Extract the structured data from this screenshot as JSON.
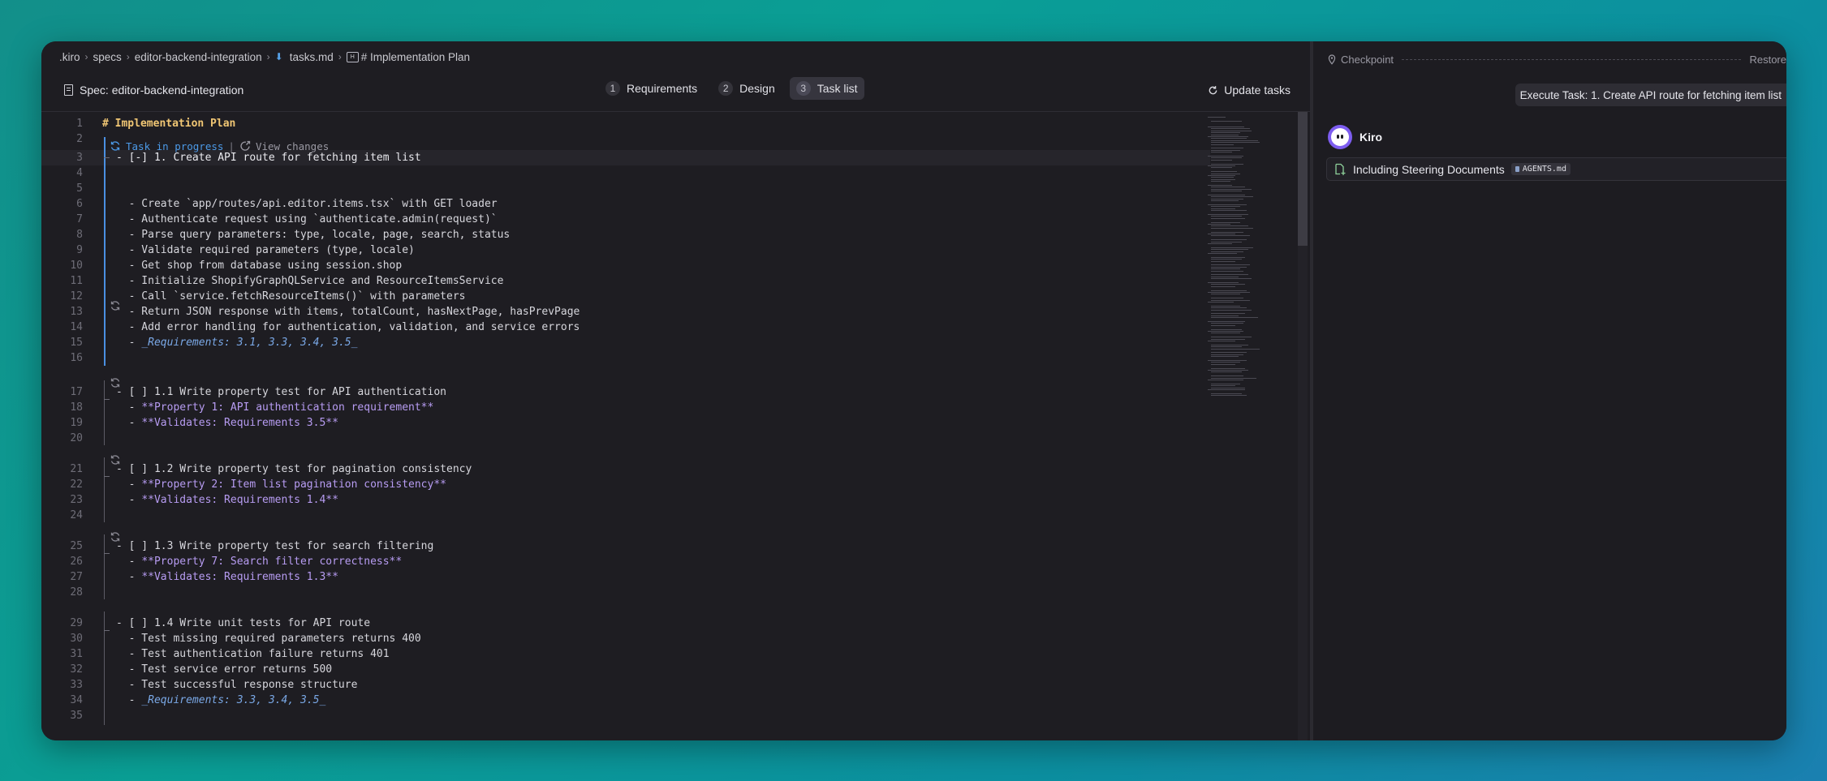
{
  "breadcrumb": {
    "items": [
      ".kiro",
      "specs",
      "editor-backend-integration",
      "tasks.md",
      "# Implementation Plan"
    ],
    "icon_md": "markdown-down-arrow-icon",
    "icon_heading": "heading-symbol-icon"
  },
  "specbar": {
    "title": "Spec: editor-backend-integration",
    "tabs": [
      {
        "num": "1",
        "label": "Requirements",
        "active": false
      },
      {
        "num": "2",
        "label": "Design",
        "active": false
      },
      {
        "num": "3",
        "label": "Task list",
        "active": true
      }
    ],
    "update_label": "Update tasks"
  },
  "lens": {
    "in_progress": "Task in progress",
    "separator": "|",
    "view_changes": "View changes"
  },
  "lines": [
    {
      "n": "1",
      "t": "# Implementation Plan"
    },
    {
      "n": "2",
      "t": ""
    },
    {
      "n": "3",
      "t": "- [-] 1. Create API route for fetching item list"
    },
    {
      "n": "4",
      "t": ""
    },
    {
      "n": "5",
      "t": ""
    },
    {
      "n": "6",
      "t": "  - Create `app/routes/api.editor.items.tsx` with GET loader"
    },
    {
      "n": "7",
      "t": "  - Authenticate request using `authenticate.admin(request)`"
    },
    {
      "n": "8",
      "t": "  - Parse query parameters: type, locale, page, search, status"
    },
    {
      "n": "9",
      "t": "  - Validate required parameters (type, locale)"
    },
    {
      "n": "10",
      "t": "  - Get shop from database using session.shop"
    },
    {
      "n": "11",
      "t": "  - Initialize ShopifyGraphQLService and ResourceItemsService"
    },
    {
      "n": "12",
      "t": "  - Call `service.fetchResourceItems()` with parameters"
    },
    {
      "n": "13",
      "t": "  - Return JSON response with items, totalCount, hasNextPage, hasPrevPage"
    },
    {
      "n": "14",
      "t": "  - Add error handling for authentication, validation, and service errors"
    },
    {
      "n": "15",
      "t": "  - ",
      "t2": "_Requirements: 3.1, 3.3, 3.4, 3.5_"
    },
    {
      "n": "16",
      "t": ""
    },
    {
      "n": "17",
      "t": "- [ ] 1.1 Write property test for API authentication"
    },
    {
      "n": "18",
      "t": "  - ",
      "t2": "**Property 1: API authentication requirement**"
    },
    {
      "n": "19",
      "t": "  - ",
      "t2": "**Validates: Requirements 3.5**"
    },
    {
      "n": "20",
      "t": ""
    },
    {
      "n": "21",
      "t": "- [ ] 1.2 Write property test for pagination consistency"
    },
    {
      "n": "22",
      "t": "  - ",
      "t2": "**Property 2: Item list pagination consistency**"
    },
    {
      "n": "23",
      "t": "  - ",
      "t2": "**Validates: Requirements 1.4**"
    },
    {
      "n": "24",
      "t": ""
    },
    {
      "n": "25",
      "t": "- [ ] 1.3 Write property test for search filtering"
    },
    {
      "n": "26",
      "t": "  - ",
      "t2": "**Property 7: Search filter correctness**"
    },
    {
      "n": "27",
      "t": "  - ",
      "t2": "**Validates: Requirements 1.3**"
    },
    {
      "n": "28",
      "t": ""
    },
    {
      "n": "29",
      "t": "- [ ] 1.4 Write unit tests for API route"
    },
    {
      "n": "30",
      "t": "  - Test missing required parameters returns 400"
    },
    {
      "n": "31",
      "t": "  - Test authentication failure returns 401"
    },
    {
      "n": "32",
      "t": "  - Test service error returns 500"
    },
    {
      "n": "33",
      "t": "  - Test successful response structure"
    },
    {
      "n": "34",
      "t": "  - ",
      "t2": "_Requirements: 3.3, 3.4, 3.5_"
    },
    {
      "n": "35",
      "t": ""
    }
  ],
  "chat": {
    "checkpoint_label": "Checkpoint",
    "restore_label": "Restore",
    "user_message": "Execute Task: 1. Create API route for fetching item list",
    "agent_name": "Kiro",
    "steering_label": "Including Steering Documents",
    "steering_file": "AGENTS.md"
  },
  "colors": {
    "heading": "#f0c674",
    "property_text": "#b79cf2",
    "requirements_text": "#7aa8e6",
    "in_progress": "#4c9ae8",
    "avatar": "#7d5df0"
  }
}
